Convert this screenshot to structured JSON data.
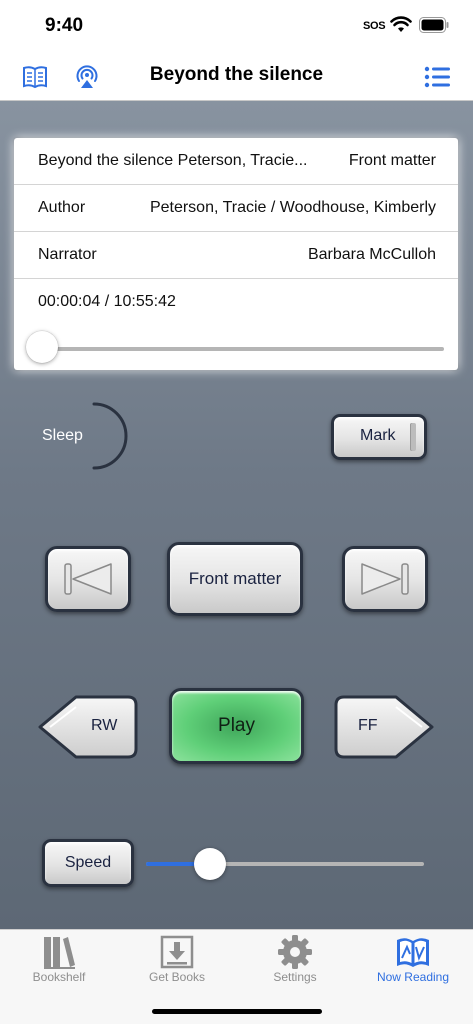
{
  "status_bar": {
    "time": "9:40",
    "signal_text": "SOS"
  },
  "nav": {
    "title": "Beyond the silence"
  },
  "info": {
    "book_line": "Beyond the silence Peterson, Tracie...",
    "chapter": "Front matter",
    "author_label": "Author",
    "author_value": "Peterson, Tracie / Woodhouse, Kimberly",
    "narrator_label": "Narrator",
    "narrator_value": "Barbara McCulloh",
    "time_display": "00:00:04 / 10:55:42",
    "progress_fraction": 0.0001
  },
  "controls": {
    "sleep_label": "Sleep",
    "mark_label": "Mark",
    "chapter_label": "Front matter",
    "rw_label": "RW",
    "play_label": "Play",
    "ff_label": "FF",
    "speed_label": "Speed",
    "speed_fraction": 0.23
  },
  "tabs": [
    {
      "label": "Bookshelf",
      "icon": "bookshelf-icon",
      "active": false
    },
    {
      "label": "Get Books",
      "icon": "download-icon",
      "active": false
    },
    {
      "label": "Settings",
      "icon": "gear-icon",
      "active": false
    },
    {
      "label": "Now Reading",
      "icon": "open-book-icon",
      "active": true
    }
  ],
  "colors": {
    "accent": "#2f6fe0",
    "play_green": "#5fcf78",
    "panel": "#6e7987"
  }
}
